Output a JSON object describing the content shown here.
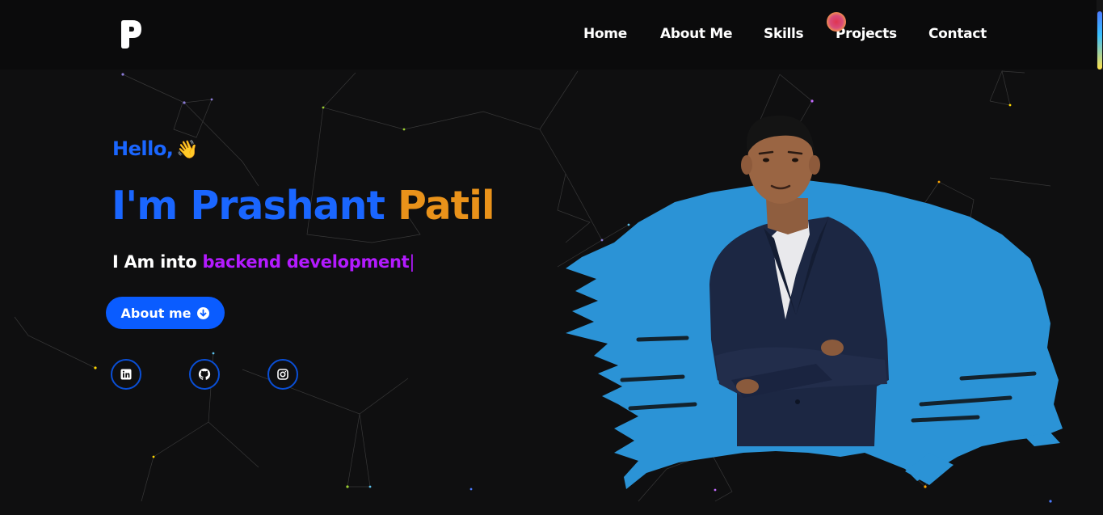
{
  "header": {
    "logo_icon": "p-logo-icon",
    "nav": [
      {
        "label": "Home"
      },
      {
        "label": "About Me"
      },
      {
        "label": "Skills"
      },
      {
        "label": "Projects"
      },
      {
        "label": "Contact"
      }
    ]
  },
  "hero": {
    "greeting": "Hello,",
    "greeting_emoji": "👋",
    "name_first": "I'm Prashant",
    "name_last": "Patil",
    "tagline_prefix": "I Am into",
    "tagline_role": "backend development",
    "caret": "|",
    "about_button": "About me",
    "socials": [
      {
        "icon": "linkedin-icon"
      },
      {
        "icon": "github-icon"
      },
      {
        "icon": "instagram-icon"
      }
    ]
  },
  "colors": {
    "background": "#0f0f10",
    "accent_blue": "#1a66ff",
    "accent_orange": "#e9921a",
    "accent_purple": "#b31aff",
    "splash_blue": "#2b93d6"
  }
}
